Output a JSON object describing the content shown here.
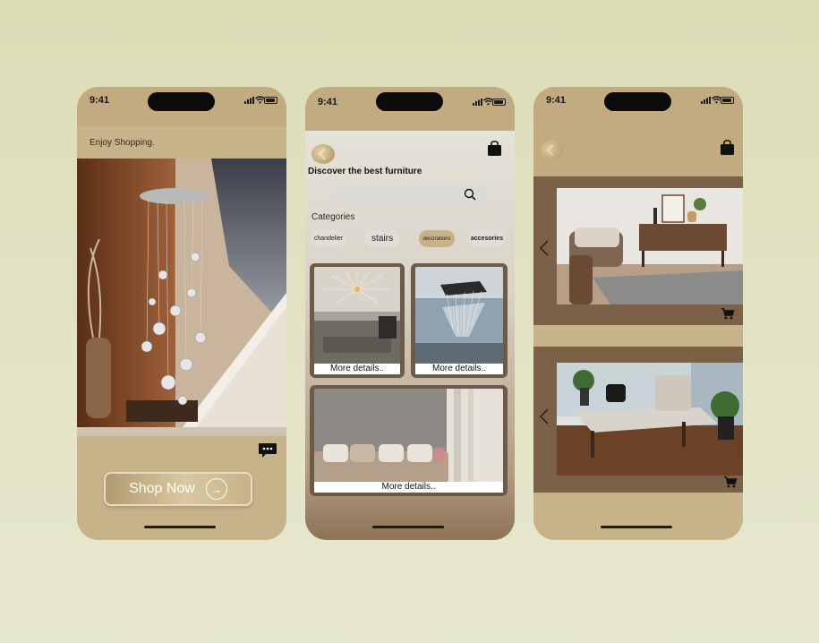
{
  "status_time": "9:41",
  "phone1": {
    "greeting": "Enjoy Shopping.",
    "shop_button_label": "Shop Now",
    "chat_icon": "chat-bubble-icon"
  },
  "phone2": {
    "title": "Discover the best furniture",
    "search_placeholder": "",
    "categories_label": "Categories",
    "categories": [
      "chandelier",
      "stairs",
      "decorations",
      "accesories"
    ],
    "cards": [
      {
        "label": "More details.."
      },
      {
        "label": "More details.."
      },
      {
        "label": "More details.."
      }
    ]
  },
  "phone3": {
    "icons": [
      "back-icon",
      "shopping-bag-icon",
      "chevron-left-icon",
      "cart-icon"
    ]
  },
  "colors": {
    "background": "#dfe0bf",
    "phone_tan": "#c6b38a",
    "brown_panel": "#7a6148",
    "card_frame": "#6e5a48"
  }
}
